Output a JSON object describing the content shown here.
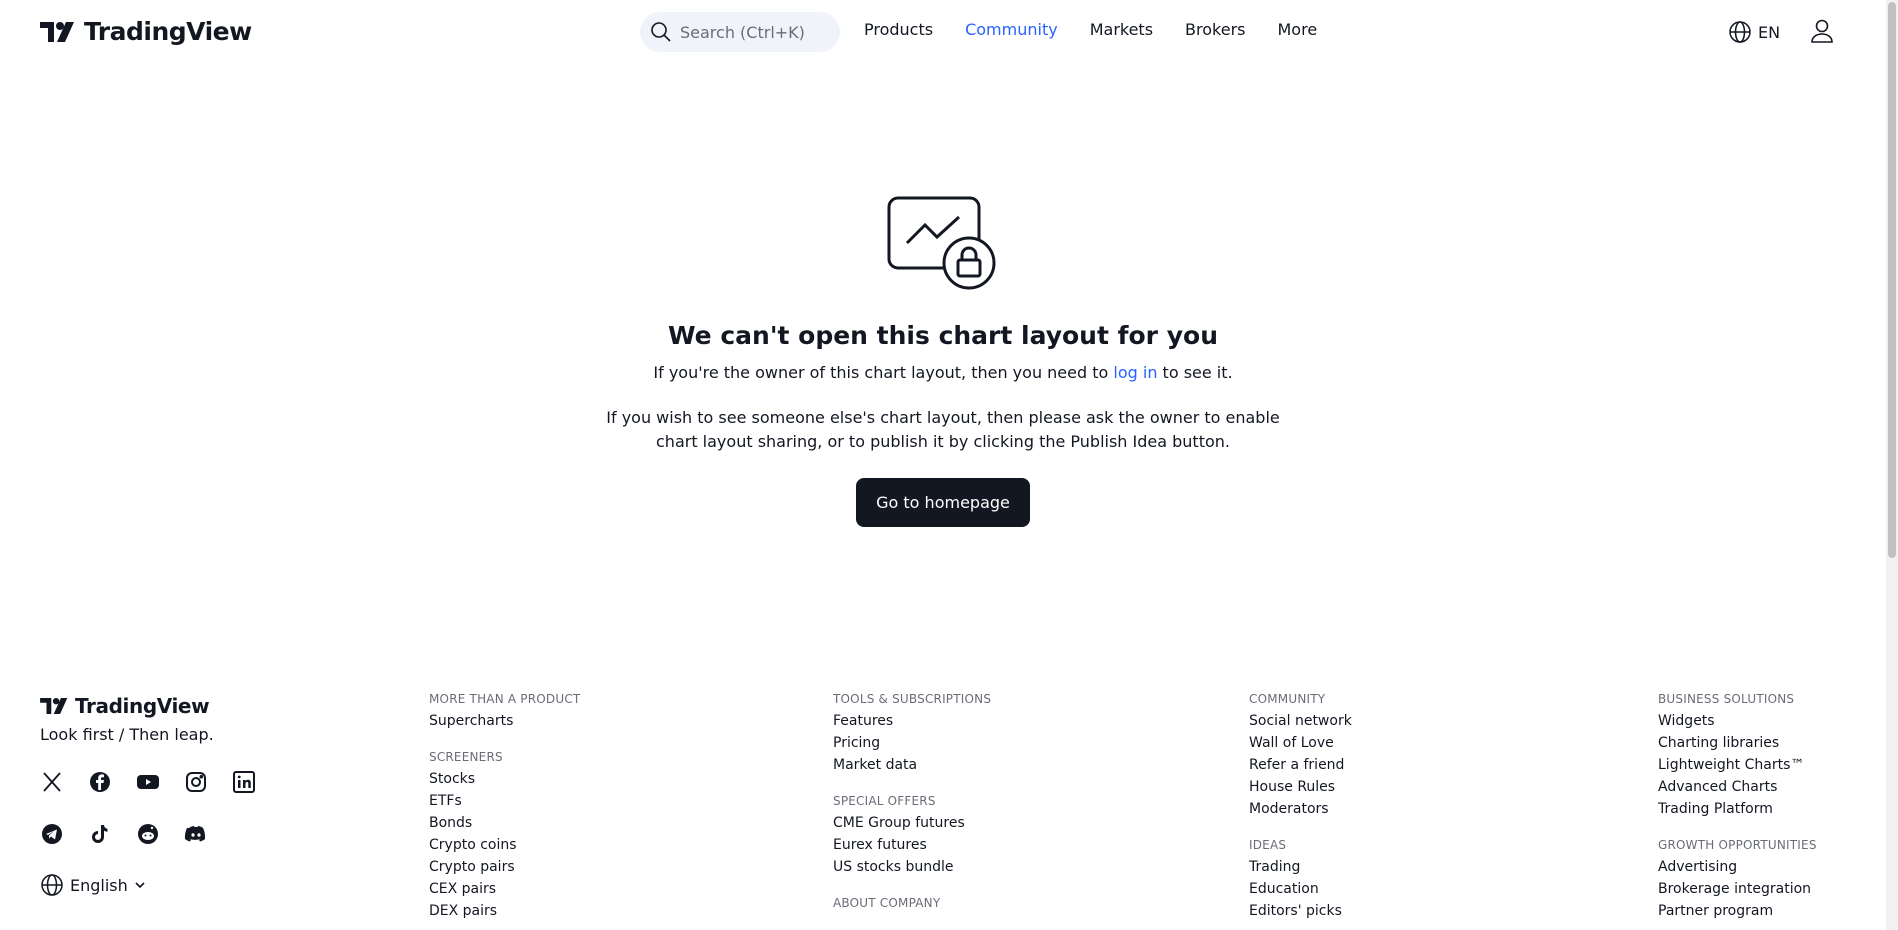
{
  "header": {
    "logo_text": "TradingView",
    "search_placeholder": "Search (Ctrl+K)",
    "nav": [
      {
        "label": "Products",
        "active": false
      },
      {
        "label": "Community",
        "active": true
      },
      {
        "label": "Markets",
        "active": false
      },
      {
        "label": "Brokers",
        "active": false
      },
      {
        "label": "More",
        "active": false
      }
    ],
    "lang": "EN"
  },
  "main": {
    "title": "We can't open this chart layout for you",
    "para1_before": "If you're the owner of this chart layout, then you need to",
    "para1_link": "log in",
    "para1_after": "to see it.",
    "para2": "If you wish to see someone else's chart layout, then please ask the owner to enable chart layout sharing, or to publish it by clicking the Publish Idea button.",
    "button": "Go to homepage"
  },
  "footer": {
    "logo_text": "TradingView",
    "tagline": "Look first / Then leap.",
    "language": "English",
    "social_icons": [
      "x-icon",
      "facebook-icon",
      "youtube-icon",
      "instagram-icon",
      "linkedin-icon",
      "telegram-icon",
      "tiktok-icon",
      "reddit-icon",
      "discord-icon"
    ],
    "columns": [
      {
        "sections": [
          {
            "heading": "MORE THAN A PRODUCT",
            "links": [
              "Supercharts"
            ]
          },
          {
            "heading": "SCREENERS",
            "links": [
              "Stocks",
              "ETFs",
              "Bonds",
              "Crypto coins",
              "Crypto pairs",
              "CEX pairs",
              "DEX pairs"
            ]
          }
        ]
      },
      {
        "sections": [
          {
            "heading": "TOOLS & SUBSCRIPTIONS",
            "links": [
              "Features",
              "Pricing",
              "Market data"
            ]
          },
          {
            "heading": "SPECIAL OFFERS",
            "links": [
              "CME Group futures",
              "Eurex futures",
              "US stocks bundle"
            ]
          },
          {
            "heading": "ABOUT COMPANY",
            "links": []
          }
        ]
      },
      {
        "sections": [
          {
            "heading": "COMMUNITY",
            "links": [
              "Social network",
              "Wall of Love",
              "Refer a friend",
              "House Rules",
              "Moderators"
            ]
          },
          {
            "heading": "IDEAS",
            "links": [
              "Trading",
              "Education",
              "Editors' picks"
            ]
          }
        ]
      },
      {
        "sections": [
          {
            "heading": "BUSINESS SOLUTIONS",
            "links": [
              "Widgets",
              "Charting libraries",
              "Lightweight Charts™",
              "Advanced Charts",
              "Trading Platform"
            ]
          },
          {
            "heading": "GROWTH OPPORTUNITIES",
            "links": [
              "Advertising",
              "Brokerage integration",
              "Partner program"
            ]
          }
        ]
      }
    ]
  }
}
